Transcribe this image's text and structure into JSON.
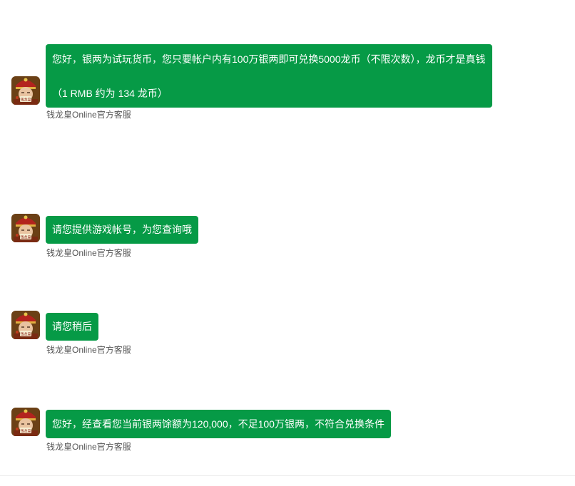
{
  "sender_name": "钱龙皇Online官方客服",
  "messages": [
    {
      "lines": [
        "您好，银两为试玩货币，您只要帐户内有100万银两即可兑换5000龙币（不限次数），龙币才是真钱",
        "（1 RMB 约为 134 龙币）"
      ]
    },
    {
      "lines": [
        "请您提供游戏帐号，为您查询哦"
      ]
    },
    {
      "lines": [
        "请您稍后"
      ]
    },
    {
      "lines": [
        "您好，经查看您当前银两馀额为120,000，不足100万银两，不符合兑换条件"
      ]
    }
  ],
  "colors": {
    "bubble": "#069a46",
    "bubble_text": "#ffffff",
    "sender_text": "#555555"
  },
  "icons": {
    "avatar": "emperor-avatar-icon"
  }
}
